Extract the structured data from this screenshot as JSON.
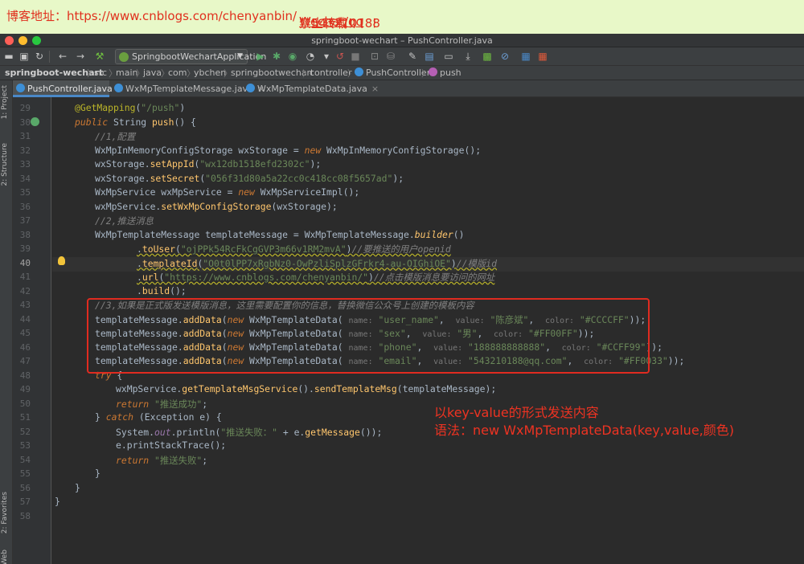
{
  "banner": {
    "site": "博客地址：https://www.cnblogs.com/chenyanbin/",
    "warning": "禁止转载！！！",
    "contact": "Wechat/qq",
    "contact_value": "：543210188"
  },
  "window": {
    "title": "springboot-wechart – PushController.java"
  },
  "toolbar": {
    "run_config": "SpringbootWechartApplication"
  },
  "breadcrumbs": [
    "springboot-wechart",
    "src",
    "main",
    "java",
    "com",
    "ybchen",
    "springbootwechart",
    "controller",
    "PushController",
    "push"
  ],
  "side_tabs": [
    "1: Project",
    "2: Structure",
    "2: Favorites",
    "Web"
  ],
  "tabs": [
    {
      "label": "PushController.java",
      "active": true
    },
    {
      "label": "WxMpTemplateMessage.java",
      "active": false
    },
    {
      "label": "WxMpTemplateData.java",
      "active": false
    }
  ],
  "close_glyph": "×",
  "line_numbers": [
    "29",
    "30",
    "31",
    "32",
    "33",
    "34",
    "35",
    "36",
    "37",
    "38",
    "39",
    "40",
    "41",
    "42",
    "43",
    "44",
    "45",
    "46",
    "47",
    "48",
    "49",
    "50",
    "51",
    "52",
    "53",
    "54",
    "55",
    "56",
    "57",
    "58"
  ],
  "current_line": "40",
  "code": {
    "l29": {
      "ann": "@GetMapping",
      "p1": "(",
      "s1": "\"/push\"",
      "p2": ")"
    },
    "l30": {
      "k1": "public",
      "t1": " String ",
      "m1": "push",
      "t2": "() {"
    },
    "l31": {
      "c": "//1,配置"
    },
    "l32": {
      "t1": "WxMpInMemoryConfigStorage wxStorage = ",
      "k1": "new",
      "t2": " WxMpInMemoryConfigStorage();"
    },
    "l33": {
      "t1": "wxStorage.",
      "m1": "setAppId",
      "t2": "(",
      "s1": "\"wx12db1518efd2302c\"",
      "t3": ");"
    },
    "l34": {
      "t1": "wxStorage.",
      "m1": "setSecret",
      "t2": "(",
      "s1": "\"056f31d80a5a22cc0c418cc08f5657ad\"",
      "t3": ");"
    },
    "l35": {
      "t1": "WxMpService wxMpService = ",
      "k1": "new",
      "t2": " WxMpServiceImpl();"
    },
    "l36": {
      "t1": "wxMpService.",
      "m1": "setWxMpConfigStorage",
      "t2": "(wxStorage);"
    },
    "l37": {
      "c": "//2,推送消息"
    },
    "l38": {
      "t1": "WxMpTemplateMessage templateMessage = WxMpTemplateMessage.",
      "m1": "builder",
      "t2": "()"
    },
    "l39": {
      "t1": ".",
      "m1": "toUser",
      "t2": "(",
      "s1": "\"ojPPk54RcFkCgGVP3m66v1RM2mvA\"",
      "t3": ")",
      "c": "//要推送的用户openid"
    },
    "l40": {
      "t1": ".",
      "m1": "templateId",
      "t2": "(",
      "s1": "\"O0t0lPP7xRgbNz0-OwPzliSplzGFrkr4-au-OIGhiOE\"",
      "t3": ")",
      "c": "//模版id"
    },
    "l41": {
      "t1": ".",
      "m1": "url",
      "t2": "(",
      "s1": "\"https://www.cnblogs.com/chenyanbin/\"",
      "t3": ")",
      "c": "//点击模版消息要访问的网址"
    },
    "l42": {
      "t1": ".",
      "m1": "build",
      "t2": "();"
    },
    "l43": {
      "c": "//3,如果是正式版发送模版消息，这里需要配置你的信息，替换微信公众号上创建的模板内容"
    },
    "data_lines": [
      {
        "key": "\"user_name\"",
        "value": "\"陈彦斌\"",
        "color": "\"#CCCCFF\""
      },
      {
        "key": "\"sex\"",
        "value": "\"男\"",
        "color": "\"#FF00FF\""
      },
      {
        "key": "\"phone\"",
        "value": "\"188888888888\"",
        "color": "\"#CCFF99\""
      },
      {
        "key": "\"email\"",
        "value": "\"543210188@qq.com\"",
        "color": "\"#FF0033\""
      }
    ],
    "data_common": {
      "t1": "templateMessage.",
      "m1": "addData",
      "t2": "(",
      "k1": "new",
      "t3": " WxMpTemplateData(",
      "h1": "name:",
      "h2": "value:",
      "h3": "color:",
      "comma": ",",
      "end": "));"
    },
    "l48": {
      "k1": "try",
      "t1": " {"
    },
    "l49": {
      "t1": "wxMpService.",
      "m1": "getTemplateMsgService",
      "t2": "().",
      "m2": "sendTemplateMsg",
      "t3": "(templateMessage);"
    },
    "l50": {
      "k1": "return",
      "s1": "\"推送成功\"",
      "t1": ";"
    },
    "l51": {
      "t1": "} ",
      "k1": "catch",
      "t2": " (Exception e) {"
    },
    "l52": {
      "t1": "System.",
      "f1": "out",
      "t2": ".println(",
      "s1": "\"推送失败：\"",
      "t3": " + e.",
      "m1": "getMessage",
      "t4": "());"
    },
    "l53": {
      "t1": "e.printStackTrace();"
    },
    "l54": {
      "k1": "return",
      "s1": "\"推送失败\"",
      "t1": ";"
    },
    "l55": {
      "t1": "}"
    },
    "l56": {
      "t1": "}"
    },
    "l57": {
      "t1": "}"
    }
  },
  "annotation_note": {
    "line1": "以key-value的形式发送内容",
    "line2": "语法：new WxMpTemplateData(key,value,颜色)"
  },
  "colors": {
    "annotation_red": "#e02b20",
    "banner_bg": "#e8f8c8",
    "editor_bg": "#2b2b2b"
  }
}
